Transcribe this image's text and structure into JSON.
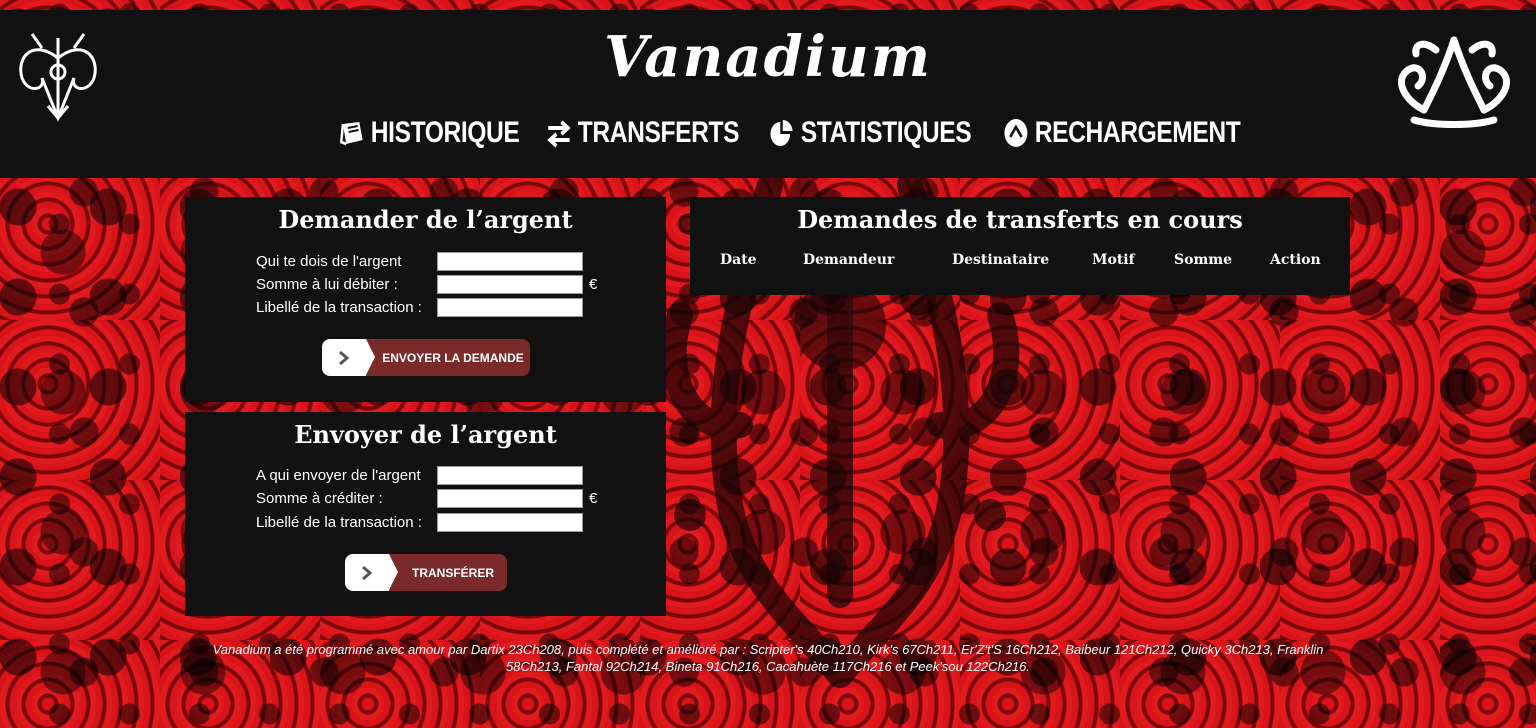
{
  "header": {
    "brand": "Vanadium",
    "nav": [
      {
        "label": "HISTORIQUE",
        "icon": "book-icon"
      },
      {
        "label": "TRANSFERTS",
        "icon": "exchange-arrows-icon"
      },
      {
        "label": "STATISTIQUES",
        "icon": "pie-chart-icon"
      },
      {
        "label": "RECHARGEMENT",
        "icon": "chevron-up-circle-icon"
      }
    ],
    "logo_left": "ornamental-crest-logo",
    "logo_right": "ornamental-flourish-logo"
  },
  "request_panel": {
    "title": "Demander de l’argent",
    "fields": [
      {
        "label": "Qui te dois de l'argent",
        "value": "",
        "unit": ""
      },
      {
        "label": "Somme à lui débiter :",
        "value": "",
        "unit": "€"
      },
      {
        "label": "Libellé de la transaction :",
        "value": "",
        "unit": ""
      }
    ],
    "button": "ENVOYER LA DEMANDE"
  },
  "send_panel": {
    "title": "Envoyer de l’argent",
    "fields": [
      {
        "label": "A qui envoyer de l'argent",
        "value": "",
        "unit": ""
      },
      {
        "label": "Somme à créditer :",
        "value": "",
        "unit": "€"
      },
      {
        "label": "Libellé de la transaction :",
        "value": "",
        "unit": ""
      }
    ],
    "button": "TRANSFÉRER"
  },
  "pending_panel": {
    "title": "Demandes de transferts en cours",
    "columns": [
      "Date",
      "Demandeur",
      "Destinataire",
      "Motif",
      "Somme",
      "Action"
    ],
    "rows": []
  },
  "footer": {
    "line1": "Vanadium a été programmé avec amour par Dartix 23Ch208, puis complété et amélioré par : Scripter's 40Ch210, Kirk's 67Ch211, Er'Z't'S 16Ch212, Baibeur 121Ch212, Quicky 3Ch213, Franklin",
    "line2": "58Ch213, Fantal 92Ch214, Bineta 91Ch216, Cacahuète 117Ch216 et Peek'sou 122Ch216."
  },
  "colors": {
    "panel_bg": "#111111",
    "button_label_bg": "#7a2a2b",
    "background_red": "#b30d10"
  }
}
